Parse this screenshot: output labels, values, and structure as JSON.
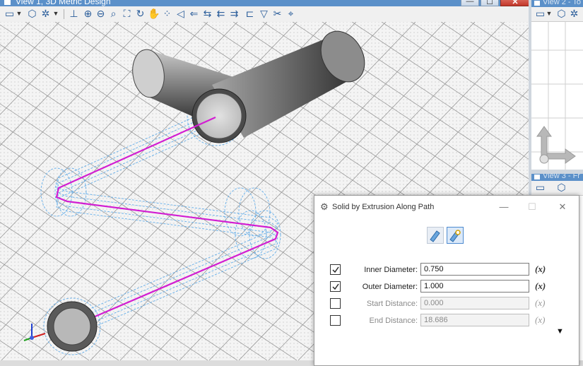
{
  "view1": {
    "title": "View 1, 3D Metric Design",
    "window_controls": {
      "minimize": "—",
      "maximize": "☐",
      "close": "✕"
    }
  },
  "view2": {
    "title": "View 2 - To"
  },
  "view3": {
    "title": "View 3 - Fr"
  },
  "dialog": {
    "title": "Solid by Extrusion Along Path",
    "controls": {
      "minimize": "—",
      "maximize": "☐",
      "close": "✕"
    },
    "fields": [
      {
        "label": "Inner Diameter:",
        "value": "0.750",
        "checked": true,
        "enabled": true
      },
      {
        "label": "Outer Diameter:",
        "value": "1.000",
        "checked": true,
        "enabled": true
      },
      {
        "label": "Start Distance:",
        "value": "0.000",
        "checked": false,
        "enabled": false
      },
      {
        "label": "End Distance:",
        "value": "18.686",
        "checked": false,
        "enabled": false
      }
    ],
    "expression_label": "(x)",
    "more_arrow": "▼"
  },
  "colors": {
    "titlebar": "#5b90c9",
    "path": "#d21ed2",
    "preview": "#6fb3ea",
    "solid": "#7a7a7a"
  }
}
